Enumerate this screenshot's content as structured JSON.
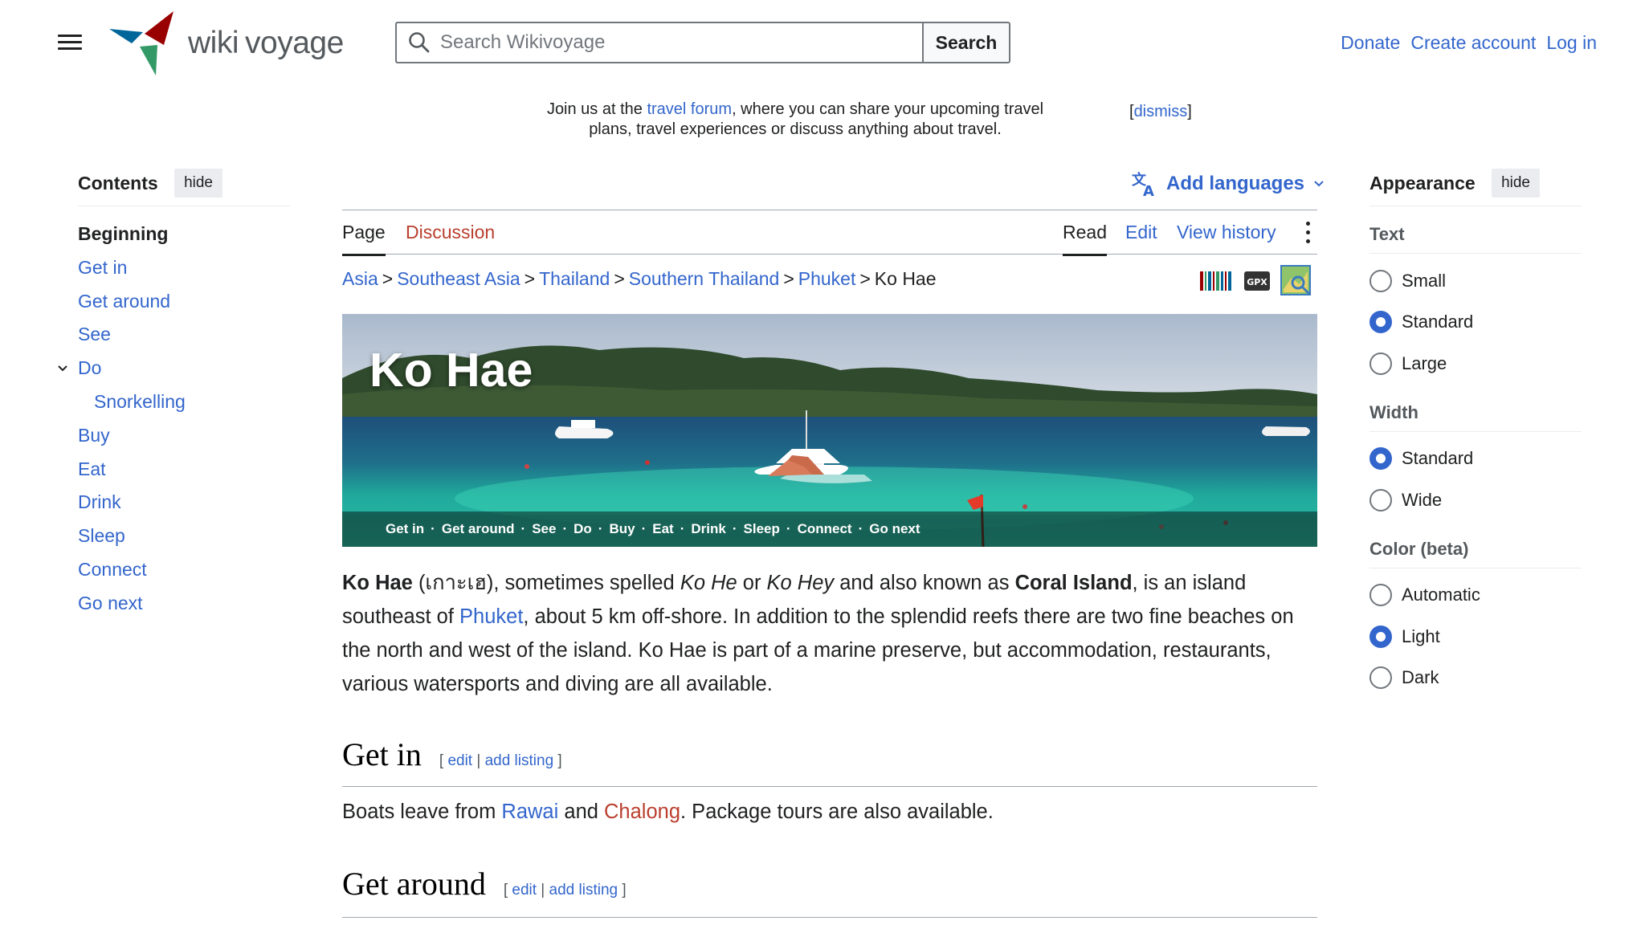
{
  "header": {
    "logo_text_a": "wiki",
    "logo_text_b": "voyage",
    "search_placeholder": "Search Wikivoyage",
    "search_button": "Search",
    "user_links": [
      "Donate",
      "Create account",
      "Log in"
    ]
  },
  "notice": {
    "prefix": "Join us at the ",
    "link": "travel forum",
    "suffix": ", where you can share your upcoming travel plans, travel experiences or discuss anything about travel.",
    "dismiss_open": "[",
    "dismiss": "dismiss",
    "dismiss_close": "]"
  },
  "toc": {
    "title": "Contents",
    "hide": "hide",
    "items": [
      {
        "label": "Beginning"
      },
      {
        "label": "Get in"
      },
      {
        "label": "Get around"
      },
      {
        "label": "See"
      },
      {
        "label": "Do"
      },
      {
        "label": "Snorkelling"
      },
      {
        "label": "Buy"
      },
      {
        "label": "Eat"
      },
      {
        "label": "Drink"
      },
      {
        "label": "Sleep"
      },
      {
        "label": "Connect"
      },
      {
        "label": "Go next"
      }
    ]
  },
  "languages": {
    "label": "Add languages"
  },
  "tabs": {
    "page": "Page",
    "discussion": "Discussion",
    "read": "Read",
    "edit": "Edit",
    "history": "View history"
  },
  "breadcrumb": {
    "items": [
      "Asia",
      "Southeast Asia",
      "Thailand",
      "Southern Thailand",
      "Phuket"
    ],
    "current": "Ko Hae",
    "sep": ">"
  },
  "indicators": {
    "gpx": "GPX"
  },
  "banner": {
    "title": "Ko Hae",
    "nav": [
      "Get in",
      "Get around",
      "See",
      "Do",
      "Buy",
      "Eat",
      "Drink",
      "Sleep",
      "Connect",
      "Go next"
    ],
    "nav_sep": "·"
  },
  "lead": {
    "name": "Ko Hae",
    "thai": " (เกาะเฮ), sometimes spelled ",
    "alt1": "Ko He",
    "or": " or ",
    "alt2": "Ko Hey",
    "aka": " and also known as ",
    "coral": "Coral Island",
    "mid": ", is an island southeast of ",
    "phuket": "Phuket",
    "rest": ", about 5 km off-shore. In addition to the splendid reefs there are two fine beaches on the north and west of the island. Ko Hae is part of a marine preserve, but accommodation, restaurants, various watersports and diving are all available."
  },
  "sections": {
    "get_in": {
      "title": "Get in",
      "bracket_open": "[ ",
      "edit": "edit",
      "pipe": " | ",
      "add_listing": "add listing",
      "bracket_close": " ]"
    },
    "get_in_text": {
      "prefix": "Boats leave from ",
      "rawai": "Rawai",
      "and": " and ",
      "chalong": "Chalong",
      "suffix": ". Package tours are also available."
    },
    "get_around": {
      "title": "Get around",
      "bracket_open": "[ ",
      "edit": "edit",
      "pipe": " | ",
      "add_listing": "add listing",
      "bracket_close": " ]"
    }
  },
  "appearance": {
    "title": "Appearance",
    "hide": "hide",
    "text_title": "Text",
    "text_options": [
      "Small",
      "Standard",
      "Large"
    ],
    "text_selected": "Standard",
    "width_title": "Width",
    "width_options": [
      "Standard",
      "Wide"
    ],
    "width_selected": "Standard",
    "color_title": "Color (beta)",
    "color_options": [
      "Automatic",
      "Light",
      "Dark"
    ],
    "color_selected": "Light"
  },
  "colors": {
    "link": "#3366cc",
    "redlink": "#ba3f2e",
    "text": "#202122",
    "border": "#a2a9b1"
  }
}
